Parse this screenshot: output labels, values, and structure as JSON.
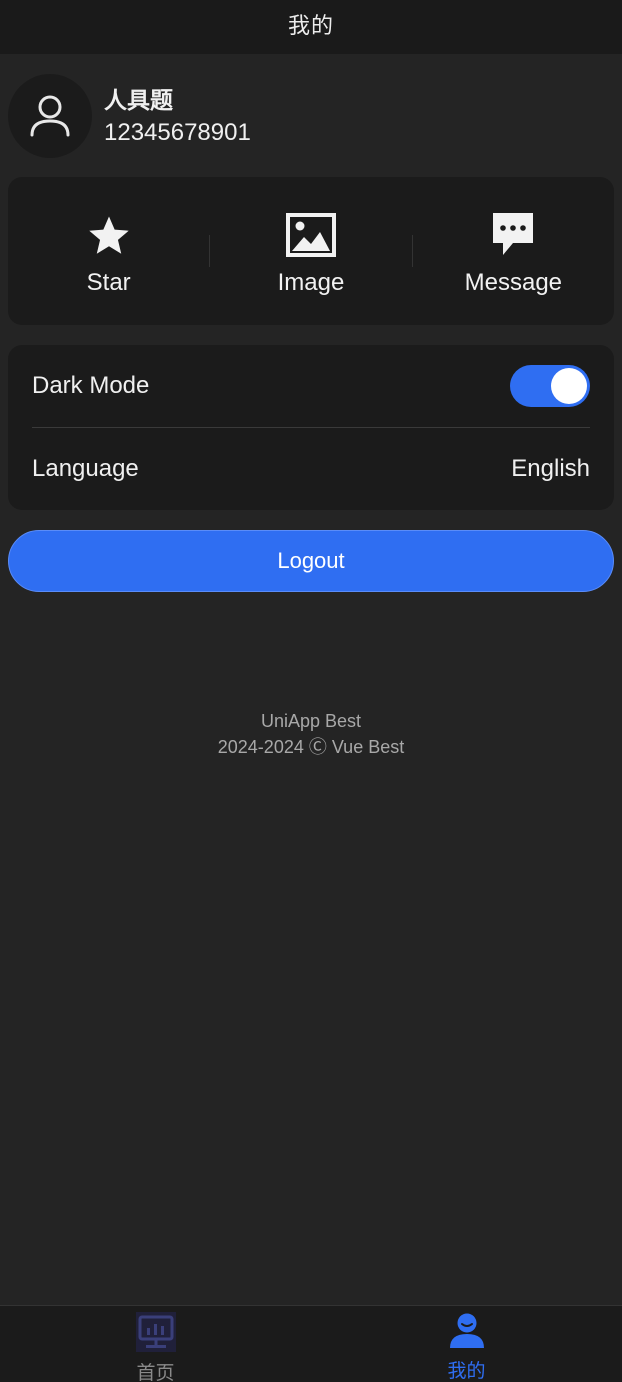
{
  "navbar": {
    "title": "我的"
  },
  "profile": {
    "name": "人具题",
    "phone": "12345678901",
    "avatar_icon": "user-outline-icon"
  },
  "shortcuts": [
    {
      "label": "Star",
      "icon": "star-icon"
    },
    {
      "label": "Image",
      "icon": "image-icon"
    },
    {
      "label": "Message",
      "icon": "message-icon"
    }
  ],
  "settings": {
    "dark_mode": {
      "label": "Dark Mode",
      "enabled": true
    },
    "language": {
      "label": "Language",
      "value": "English"
    }
  },
  "logout": {
    "label": "Logout"
  },
  "footer": {
    "line1": "UniApp Best",
    "line2": "2024-2024 Ⓒ Vue Best"
  },
  "tabbar": {
    "tabs": [
      {
        "label": "首页",
        "icon": "dashboard-monitor-icon",
        "active": false
      },
      {
        "label": "我的",
        "icon": "user-filled-icon",
        "active": true
      }
    ]
  },
  "colors": {
    "accent": "#2f6ef2",
    "background": "#242424",
    "card": "#1b1b1b",
    "navbar": "#1a1a1a"
  }
}
